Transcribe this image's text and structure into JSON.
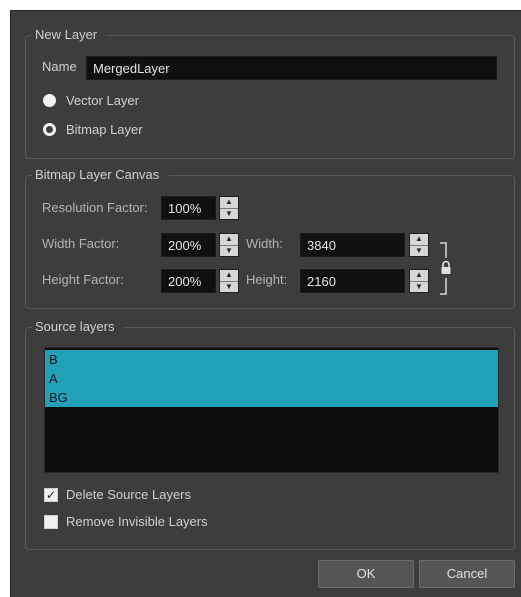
{
  "new_layer": {
    "title": "New Layer",
    "name_label": "Name",
    "name_value": "MergedLayer",
    "options": [
      {
        "label": "Vector Layer",
        "selected": false
      },
      {
        "label": "Bitmap Layer",
        "selected": true
      }
    ]
  },
  "canvas": {
    "title": "Bitmap Layer Canvas",
    "resolution_label": "Resolution Factor:",
    "resolution_value": "100%",
    "width_factor_label": "Width Factor:",
    "width_factor_value": "200%",
    "width_label": "Width:",
    "width_value": "3840",
    "height_factor_label": "Height Factor:",
    "height_factor_value": "200%",
    "height_label": "Height:",
    "height_value": "2160",
    "icons": [
      "spin-up-down-icon",
      "lock-icon",
      "link-bracket-icon"
    ]
  },
  "source": {
    "title": "Source layers",
    "layers": [
      "B",
      "A",
      "BG"
    ],
    "delete_label": "Delete Source Layers",
    "delete_checked": true,
    "remove_invisible_label": "Remove Invisible Layers",
    "remove_invisible_checked": false
  },
  "buttons": {
    "ok": "OK",
    "cancel": "Cancel"
  },
  "colors": {
    "background": "#3d3d3d",
    "selection": "#21a0b8",
    "field": "#101010"
  }
}
